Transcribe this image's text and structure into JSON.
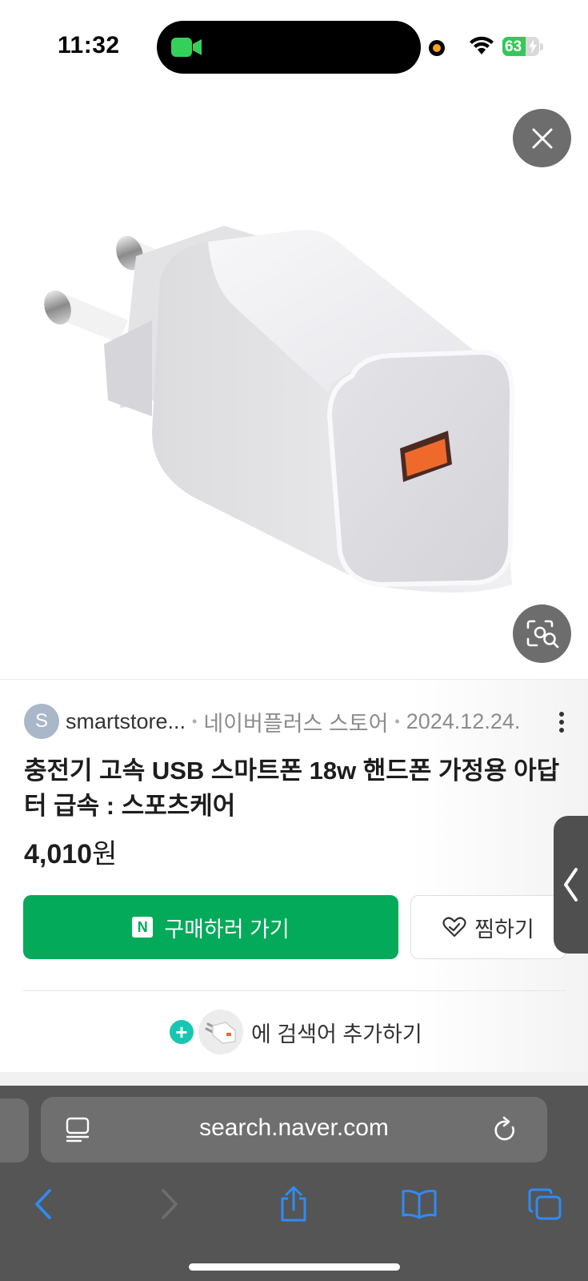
{
  "status_bar": {
    "time": "11:32",
    "battery_level": "63",
    "battery_fraction": 0.63,
    "icons": [
      "facetime-camera-icon",
      "recording-dot-icon",
      "wifi-icon",
      "battery-charging-icon"
    ]
  },
  "viewer": {
    "close_icon": "close-icon",
    "lens_icon": "visual-search-icon",
    "image_alt": "white USB charger adapter"
  },
  "result": {
    "avatar_letter": "S",
    "site": "smartstore...",
    "store": "네이버플러스 스토어",
    "date": "2024.12.24.",
    "title": "충전기 고속 USB 스마트폰 18w 핸드폰 가정용 아답터 급속 : 스포츠케어",
    "price_amount": "4,010",
    "price_unit": "원",
    "buy_label": "구매하러 가기",
    "buy_badge": "N",
    "wish_label": "찜하기",
    "add_keyword_label": "에 검색어 추가하기"
  },
  "browser": {
    "url": "search.naver.com",
    "nav_icons": [
      "back-icon",
      "forward-icon",
      "share-icon",
      "bookmarks-icon",
      "tabs-icon"
    ]
  },
  "colors": {
    "buy_green": "#03aa5a",
    "plus_teal": "#19c6b3",
    "toolbar_gray": "#555555",
    "overlay_button": "#6d6d6d",
    "usb_port_orange": "#ef6a2a"
  }
}
